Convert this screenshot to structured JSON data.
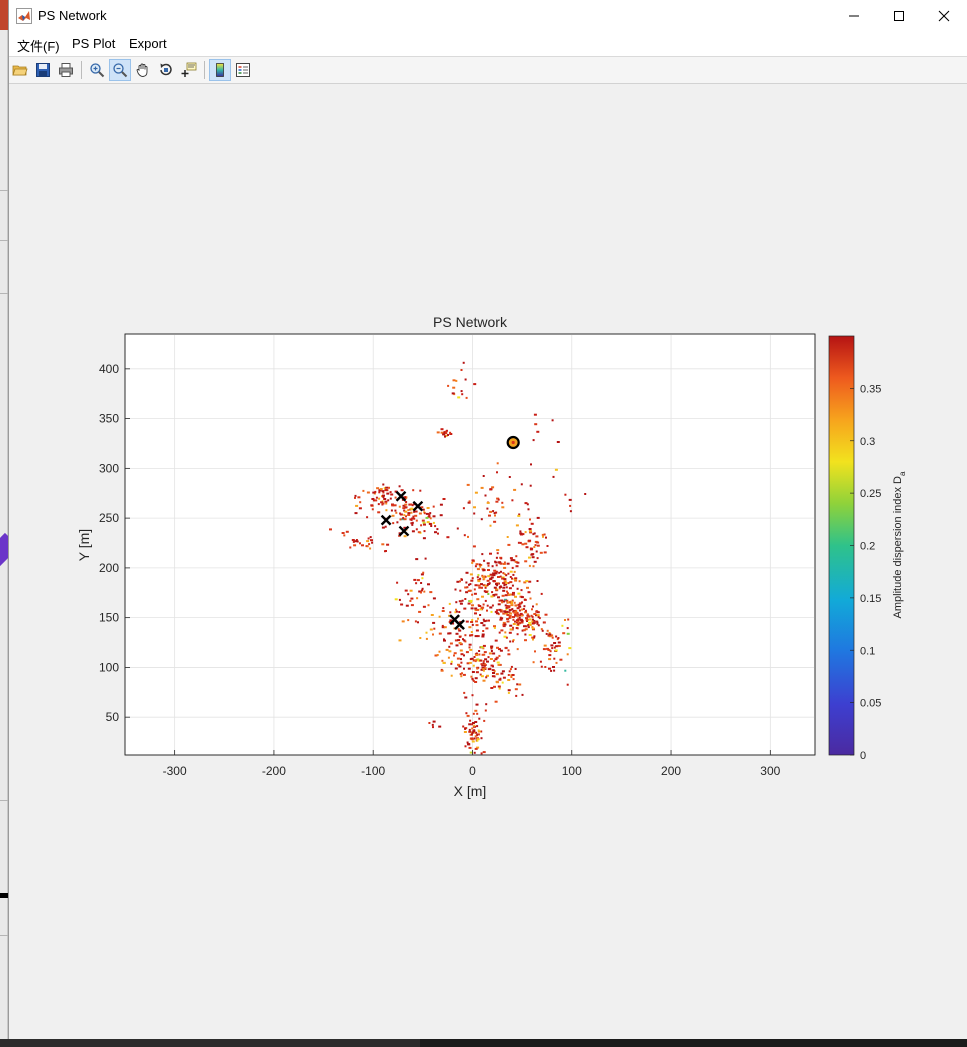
{
  "window": {
    "title": "PS Network",
    "controls": {
      "minimize": "minimize",
      "maximize": "maximize",
      "close": "close"
    }
  },
  "menu": {
    "items": [
      "文件(F)",
      "PS Plot",
      "Export"
    ]
  },
  "toolbar": {
    "buttons": [
      {
        "icon": "open-folder-icon"
      },
      {
        "icon": "save-icon"
      },
      {
        "icon": "print-icon"
      },
      {
        "icon": "zoom-in-icon"
      },
      {
        "icon": "zoom-out-icon",
        "active": true
      },
      {
        "icon": "pan-hand-icon"
      },
      {
        "icon": "rotate-3d-icon"
      },
      {
        "icon": "data-cursor-icon"
      },
      {
        "icon": "colorbar-icon",
        "active": true
      },
      {
        "icon": "legend-icon"
      }
    ]
  },
  "chart_data": {
    "type": "scatter",
    "title": "PS Network",
    "xlabel": "X [m]",
    "ylabel": "Y [m]",
    "xlim": [
      -350,
      345
    ],
    "ylim": [
      12,
      435
    ],
    "xticks": [
      -300,
      -200,
      -100,
      0,
      100,
      200,
      300
    ],
    "yticks": [
      50,
      100,
      150,
      200,
      250,
      300,
      350,
      400
    ],
    "grid": true,
    "colorbar": {
      "label": "Amplitude dispersion index D",
      "label_subscript": "a",
      "range": [
        0,
        0.4
      ],
      "ticks": [
        "0",
        "0.05",
        "0.1",
        "0.15",
        "0.2",
        "0.25",
        "0.3",
        "0.35"
      ],
      "colormap": "parula-like (purple-blue-cyan-green-yellow-orange-red)"
    },
    "clusters": [
      {
        "cx": 45,
        "cy": 155,
        "sx": 14,
        "sy": 10,
        "n": 180,
        "angle": -35
      },
      {
        "cx": 20,
        "cy": 190,
        "sx": 15,
        "sy": 12,
        "n": 160,
        "angle": 0
      },
      {
        "cx": 10,
        "cy": 100,
        "sx": 22,
        "sy": 12,
        "n": 140,
        "angle": -25
      },
      {
        "cx": -5,
        "cy": 140,
        "sx": 28,
        "sy": 20,
        "n": 150,
        "angle": 0
      },
      {
        "cx": 0,
        "cy": 35,
        "sx": 5,
        "sy": 12,
        "n": 60,
        "angle": 0
      },
      {
        "cx": -65,
        "cy": 255,
        "sx": 18,
        "sy": 10,
        "n": 120,
        "angle": -20
      },
      {
        "cx": -95,
        "cy": 275,
        "sx": 10,
        "sy": 6,
        "n": 40,
        "angle": 0
      },
      {
        "cx": -110,
        "cy": 225,
        "sx": 14,
        "sy": 4,
        "n": 25,
        "angle": -20
      },
      {
        "cx": 80,
        "cy": 120,
        "sx": 8,
        "sy": 15,
        "n": 50,
        "angle": 0
      },
      {
        "cx": 55,
        "cy": 225,
        "sx": 10,
        "sy": 12,
        "n": 50,
        "angle": 0
      },
      {
        "cx": 20,
        "cy": 260,
        "sx": 25,
        "sy": 20,
        "n": 55,
        "angle": 0
      },
      {
        "cx": -30,
        "cy": 338,
        "sx": 4,
        "sy": 3,
        "n": 14,
        "angle": 0
      },
      {
        "cx": -15,
        "cy": 385,
        "sx": 5,
        "sy": 10,
        "n": 14,
        "angle": 0
      },
      {
        "cx": -60,
        "cy": 180,
        "sx": 10,
        "sy": 15,
        "n": 25,
        "angle": 0
      },
      {
        "cx": 70,
        "cy": 340,
        "sx": 10,
        "sy": 10,
        "n": 6,
        "angle": 0
      },
      {
        "cx": 100,
        "cy": 265,
        "sx": 5,
        "sy": 5,
        "n": 5,
        "angle": 0
      },
      {
        "cx": -40,
        "cy": 45,
        "sx": 3,
        "sy": 3,
        "n": 5,
        "angle": 0
      }
    ],
    "markers": [
      {
        "type": "x",
        "x": -72,
        "y": 272
      },
      {
        "type": "x",
        "x": -55,
        "y": 262
      },
      {
        "type": "x",
        "x": -87,
        "y": 248
      },
      {
        "type": "x",
        "x": -69,
        "y": 237
      },
      {
        "type": "x",
        "x": -18,
        "y": 148
      },
      {
        "type": "x",
        "x": -13,
        "y": 143
      },
      {
        "type": "o",
        "x": 41,
        "y": 326
      }
    ]
  }
}
